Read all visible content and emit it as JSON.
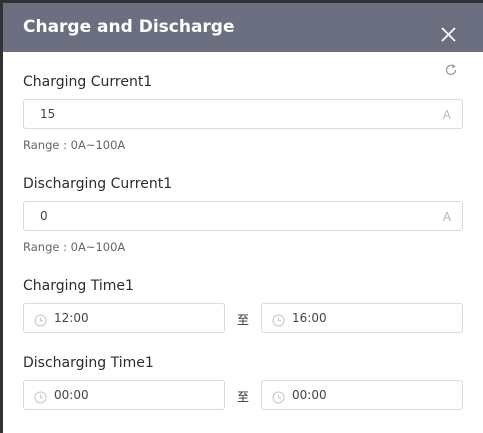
{
  "dialog": {
    "title": "Charge and Discharge",
    "close_icon": "close-icon",
    "refresh_icon": "refresh-icon"
  },
  "fields": {
    "charging_current": {
      "label": "Charging Current1",
      "value": "15",
      "unit": "A",
      "range": "Range :  0A~100A"
    },
    "discharging_current": {
      "label": "Discharging Current1",
      "value": "0",
      "unit": "A",
      "range": "Range :  0A~100A"
    },
    "charging_time": {
      "label": "Charging Time1",
      "start": "12:00",
      "separator": "至",
      "end": "16:00"
    },
    "discharging_time": {
      "label": "Discharging Time1",
      "start": "00:00",
      "separator": "至",
      "end": "00:00"
    }
  },
  "colors": {
    "header_bg": "#6c6f7f",
    "border": "#d9dbe0"
  }
}
